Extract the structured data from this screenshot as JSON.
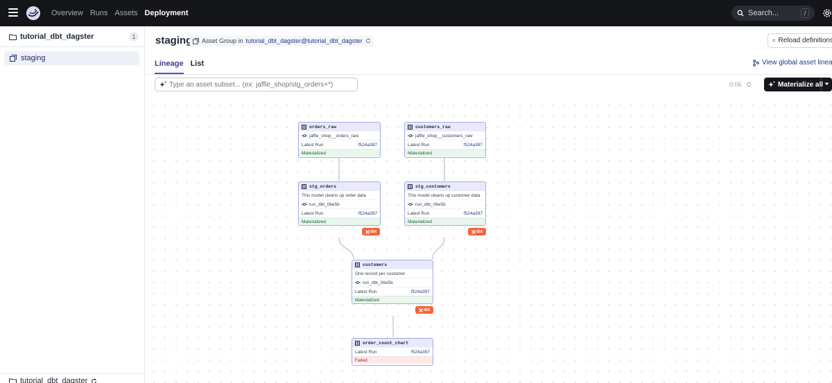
{
  "nav": {
    "links": [
      "Overview",
      "Runs",
      "Assets",
      "Deployment"
    ],
    "search_placeholder": "Search...",
    "search_shortcut": "/"
  },
  "sidebar": {
    "repo": "tutorial_dbt_dagster",
    "count": "1",
    "items": [
      {
        "label": "staging"
      }
    ],
    "footer": "tutorial_dbt_dagster"
  },
  "header": {
    "title": "staging",
    "group_prefix": "Asset Group in",
    "group_link": "tutorial_dbt_dagster@tutorial_dbt_dagster",
    "reload_label": "Reload definitions",
    "tabs": [
      "Lineage",
      "List"
    ],
    "global_link": "View global asset lineage",
    "filter_placeholder": "Type an asset subset... (ex: jaffle_shop/stg_orders+*)",
    "timer": "0:06",
    "materialize_label": "Materialize all"
  },
  "graph": {
    "latest_run_label": "Latest Run",
    "dbt_label": "dbt",
    "nodes": {
      "orders_raw": {
        "name": "orders_raw",
        "op": "jaffle_shop__orders_raw",
        "run": "f524a397",
        "status": "Materialized"
      },
      "customers_raw": {
        "name": "customers_raw",
        "op": "jaffle_shop__customers_raw",
        "run": "f524a397",
        "status": "Materialized"
      },
      "stg_orders": {
        "name": "stg_orders",
        "desc": "This model cleans up order data",
        "op": "run_dbt_06e5b",
        "run": "f524a397",
        "status": "Materialized"
      },
      "stg_customers": {
        "name": "stg_customers",
        "desc": "This model cleans up customer data",
        "op": "run_dbt_06e5b",
        "run": "f524a397",
        "status": "Materialized"
      },
      "customers": {
        "name": "customers",
        "desc": "One record per customer",
        "op": "run_dbt_06e5b",
        "run": "f524a397",
        "status": "Materialized"
      },
      "order_count_chart": {
        "name": "order_count_chart",
        "run": "f524a397",
        "status": "Failed"
      }
    }
  },
  "colors": {
    "nav_bg": "#15161a",
    "accent": "#4f46e5",
    "node_border": "#a5a9e6",
    "materialized": "#166534",
    "failed": "#b91c1c",
    "dbt_badge": "#f4633a"
  }
}
